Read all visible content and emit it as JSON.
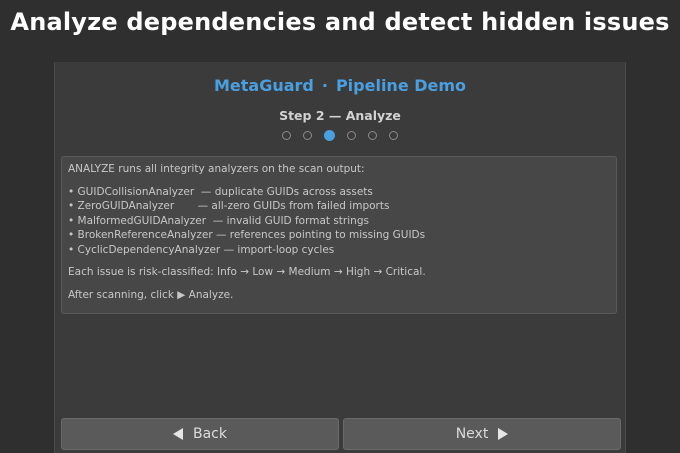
{
  "headline": "Analyze dependencies and detect hidden issues",
  "app": {
    "name": "MetaGuard",
    "separator": "·",
    "subtitle": "Pipeline Demo"
  },
  "wizard": {
    "step_title": "Step 2 — Analyze",
    "total_steps": 6,
    "current_step": 3
  },
  "info": {
    "intro": "ANALYZE runs all integrity analyzers on the scan output:",
    "analyzers": [
      "• GUIDCollisionAnalyzer  — duplicate GUIDs across assets",
      "• ZeroGUIDAnalyzer       — all-zero GUIDs from failed imports",
      "• MalformedGUIDAnalyzer  — invalid GUID format strings",
      "• BrokenReferenceAnalyzer — references pointing to missing GUIDs",
      "• CyclicDependencyAnalyzer — import-loop cycles"
    ],
    "risk_note": "Each issue is risk-classified: Info → Low → Medium → High → Critical.",
    "after_note": "After scanning, click ▶ Analyze."
  },
  "nav": {
    "back_label": "Back",
    "next_label": "Next"
  },
  "colors": {
    "accent": "#4a9fe0",
    "background": "#2f2f2f",
    "panel": "#3b3b3b"
  }
}
